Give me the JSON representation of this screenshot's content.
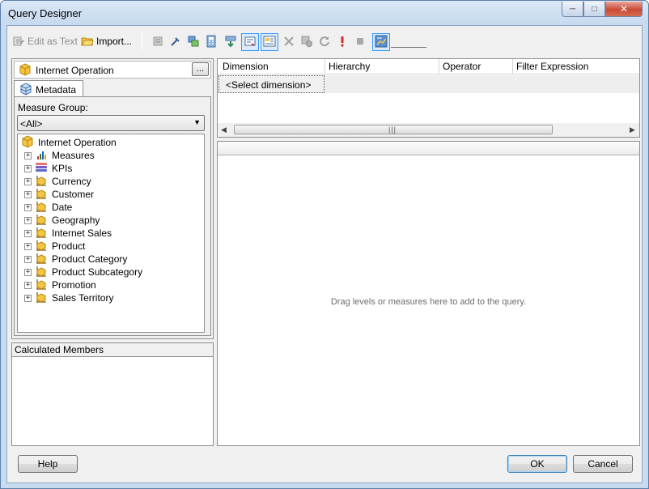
{
  "window": {
    "title": "Query Designer"
  },
  "toolbar": {
    "edit_as_text": "Edit as Text",
    "import": "Import..."
  },
  "cube": {
    "name": "Internet Operation",
    "browse_label": "..."
  },
  "tabs": [
    {
      "label": "Metadata"
    }
  ],
  "measure_group": {
    "label": "Measure Group:",
    "selected": "<All>"
  },
  "tree": {
    "root": "Internet Operation",
    "items": [
      {
        "label": "Measures",
        "icon": "measures-icon"
      },
      {
        "label": "KPIs",
        "icon": "kpis-icon"
      },
      {
        "label": "Currency",
        "icon": "dimension-icon"
      },
      {
        "label": "Customer",
        "icon": "dimension-icon"
      },
      {
        "label": "Date",
        "icon": "dimension-icon"
      },
      {
        "label": "Geography",
        "icon": "dimension-icon"
      },
      {
        "label": "Internet Sales",
        "icon": "dimension-icon"
      },
      {
        "label": "Product",
        "icon": "dimension-icon"
      },
      {
        "label": "Product Category",
        "icon": "dimension-icon"
      },
      {
        "label": "Product Subcategory",
        "icon": "dimension-icon"
      },
      {
        "label": "Promotion",
        "icon": "dimension-icon"
      },
      {
        "label": "Sales Territory",
        "icon": "dimension-icon"
      }
    ]
  },
  "calculated_members": {
    "label": "Calculated Members"
  },
  "filter_grid": {
    "columns": [
      "Dimension",
      "Hierarchy",
      "Operator",
      "Filter Expression"
    ],
    "first_row": "<Select dimension>"
  },
  "data_pane": {
    "hint": "Drag levels or measures here to add to the query."
  },
  "buttons": {
    "help": "Help",
    "ok": "OK",
    "cancel": "Cancel"
  }
}
